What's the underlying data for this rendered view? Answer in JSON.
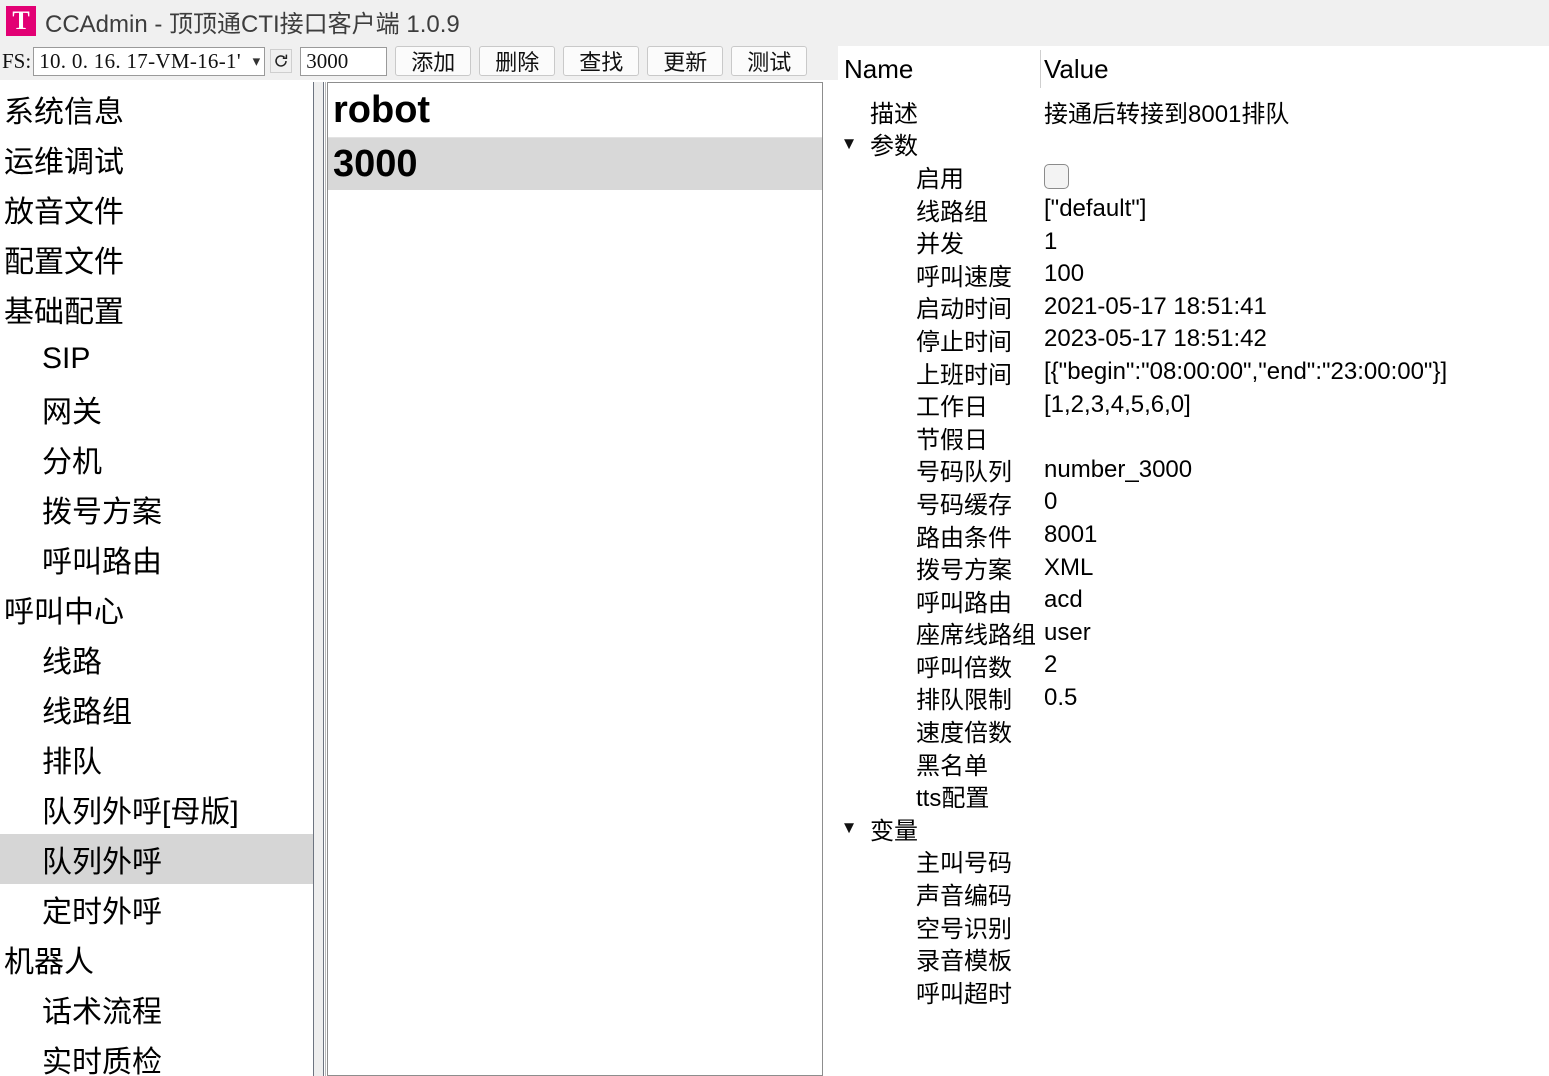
{
  "window": {
    "icon": "app-logo-t-icon",
    "icon_letter": "T",
    "icon_color": "#e20074",
    "title": "CCAdmin - 顶顶通CTI接口客户端 1.0.9"
  },
  "toolbar": {
    "fs_label": "FS:",
    "fs_value": "10. 0. 16. 17-VM-16-1'",
    "refresh_icon": "refresh-icon",
    "search_value": "3000",
    "search_placeholder": "",
    "buttons": [
      {
        "label": "添加",
        "name": "add-button"
      },
      {
        "label": "删除",
        "name": "delete-button"
      },
      {
        "label": "查找",
        "name": "find-button"
      },
      {
        "label": "更新",
        "name": "update-button"
      },
      {
        "label": "测试",
        "name": "test-button"
      }
    ]
  },
  "sidebar": {
    "items": [
      {
        "label": "系统信息",
        "level": 0,
        "selected": false
      },
      {
        "label": "运维调试",
        "level": 0,
        "selected": false
      },
      {
        "label": "放音文件",
        "level": 0,
        "selected": false
      },
      {
        "label": "配置文件",
        "level": 0,
        "selected": false
      },
      {
        "label": "基础配置",
        "level": 0,
        "selected": false
      },
      {
        "label": "SIP",
        "level": 1,
        "selected": false
      },
      {
        "label": "网关",
        "level": 1,
        "selected": false
      },
      {
        "label": "分机",
        "level": 1,
        "selected": false
      },
      {
        "label": "拨号方案",
        "level": 1,
        "selected": false
      },
      {
        "label": "呼叫路由",
        "level": 1,
        "selected": false
      },
      {
        "label": "呼叫中心",
        "level": 0,
        "selected": false
      },
      {
        "label": "线路",
        "level": 1,
        "selected": false
      },
      {
        "label": "线路组",
        "level": 1,
        "selected": false
      },
      {
        "label": "排队",
        "level": 1,
        "selected": false
      },
      {
        "label": "队列外呼[母版]",
        "level": 1,
        "selected": false
      },
      {
        "label": "队列外呼",
        "level": 1,
        "selected": true
      },
      {
        "label": "定时外呼",
        "level": 1,
        "selected": false
      },
      {
        "label": "机器人",
        "level": 0,
        "selected": false
      },
      {
        "label": "话术流程",
        "level": 1,
        "selected": false
      },
      {
        "label": "实时质检",
        "level": 1,
        "selected": false
      }
    ]
  },
  "list_panel": {
    "header": "robot",
    "rows": [
      {
        "label": "3000",
        "selected": true
      }
    ]
  },
  "properties": {
    "col_name": "Name",
    "col_value": "Value",
    "rows": [
      {
        "name": "描述",
        "value": "接通后转接到8001排队",
        "depth": 1,
        "chevron": "",
        "type": "text"
      },
      {
        "name": "参数",
        "value": "",
        "depth": 1,
        "chevron": "▼",
        "type": "group"
      },
      {
        "name": "启用",
        "value": "",
        "depth": 2,
        "chevron": "",
        "type": "checkbox",
        "checked": false
      },
      {
        "name": "线路组",
        "value": "[\"default\"]",
        "depth": 2,
        "chevron": "",
        "type": "text"
      },
      {
        "name": "并发",
        "value": "1",
        "depth": 2,
        "chevron": "",
        "type": "text"
      },
      {
        "name": "呼叫速度",
        "value": "100",
        "depth": 2,
        "chevron": "",
        "type": "text"
      },
      {
        "name": "启动时间",
        "value": "2021-05-17 18:51:41",
        "depth": 2,
        "chevron": "",
        "type": "text"
      },
      {
        "name": "停止时间",
        "value": "2023-05-17 18:51:42",
        "depth": 2,
        "chevron": "",
        "type": "text"
      },
      {
        "name": "上班时间",
        "value": "[{\"begin\":\"08:00:00\",\"end\":\"23:00:00\"}]",
        "depth": 2,
        "chevron": "",
        "type": "text"
      },
      {
        "name": "工作日",
        "value": "[1,2,3,4,5,6,0]",
        "depth": 2,
        "chevron": "",
        "type": "text"
      },
      {
        "name": "节假日",
        "value": "",
        "depth": 2,
        "chevron": "",
        "type": "text"
      },
      {
        "name": "号码队列",
        "value": "number_3000",
        "depth": 2,
        "chevron": "",
        "type": "text"
      },
      {
        "name": "号码缓存",
        "value": "0",
        "depth": 2,
        "chevron": "",
        "type": "text"
      },
      {
        "name": "路由条件",
        "value": "8001",
        "depth": 2,
        "chevron": "",
        "type": "text"
      },
      {
        "name": "拨号方案",
        "value": "XML",
        "depth": 2,
        "chevron": "",
        "type": "text"
      },
      {
        "name": "呼叫路由",
        "value": "acd",
        "depth": 2,
        "chevron": "",
        "type": "text"
      },
      {
        "name": "座席线路组",
        "value": "user",
        "depth": 2,
        "chevron": "",
        "type": "text"
      },
      {
        "name": "呼叫倍数",
        "value": "2",
        "depth": 2,
        "chevron": "",
        "type": "text"
      },
      {
        "name": "排队限制",
        "value": "0.5",
        "depth": 2,
        "chevron": "",
        "type": "text"
      },
      {
        "name": "速度倍数",
        "value": "",
        "depth": 2,
        "chevron": "",
        "type": "text"
      },
      {
        "name": "黑名单",
        "value": "",
        "depth": 2,
        "chevron": "",
        "type": "text"
      },
      {
        "name": "tts配置",
        "value": "",
        "depth": 2,
        "chevron": "",
        "type": "text"
      },
      {
        "name": "变量",
        "value": "",
        "depth": 1,
        "chevron": "▼",
        "type": "group"
      },
      {
        "name": "主叫号码",
        "value": "",
        "depth": 2,
        "chevron": "",
        "type": "text"
      },
      {
        "name": "声音编码",
        "value": "",
        "depth": 2,
        "chevron": "",
        "type": "text"
      },
      {
        "name": "空号识别",
        "value": "",
        "depth": 2,
        "chevron": "",
        "type": "text"
      },
      {
        "name": "录音模板",
        "value": "",
        "depth": 2,
        "chevron": "",
        "type": "text"
      },
      {
        "name": "呼叫超时",
        "value": "",
        "depth": 2,
        "chevron": "",
        "type": "text"
      }
    ]
  }
}
